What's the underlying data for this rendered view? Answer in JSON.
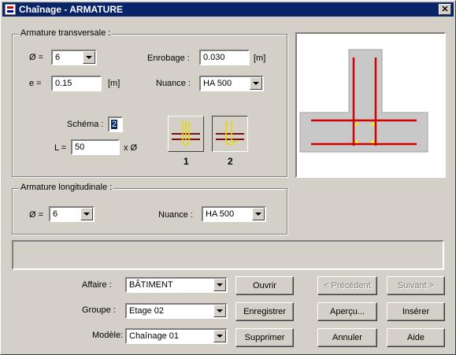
{
  "window": {
    "title": "Chaînage - ARMATURE",
    "close_glyph": "✕"
  },
  "transversale": {
    "legend": "Armature transversale :",
    "diam_label": "Ø =",
    "diam_value": "6",
    "e_label": "e =",
    "e_value": "0.15",
    "e_unit": "[m]",
    "enrobage_label": "Enrobage :",
    "enrobage_value": "0.030",
    "enrobage_unit": "[m]",
    "nuance_label": "Nuance :",
    "nuance_value": "HA 500",
    "schema_label": "Schéma :",
    "schema_value": "2",
    "L_label": "L =",
    "L_value": "50",
    "L_unit": "x Ø",
    "schema1_num": "1",
    "schema2_num": "2"
  },
  "longitudinale": {
    "legend": "Armature longitudinale :",
    "diam_label": "Ø =",
    "diam_value": "6",
    "nuance_label": "Nuance :",
    "nuance_value": "HA 500"
  },
  "bottom": {
    "affaire_label": "Affaire :",
    "affaire_value": "BÂTIMENT",
    "groupe_label": "Groupe :",
    "groupe_value": "Etage 02",
    "modele_label": "Modèle:",
    "modele_value": "Chaînage 01"
  },
  "buttons": {
    "ouvrir": "Ouvrir",
    "enregistrer": "Enregistrer",
    "supprimer": "Supprimer",
    "precedent": "< Précédent",
    "suivant": "Suivant >",
    "apercu": "Aperçu...",
    "inserer": "Insérer",
    "annuler": "Annuler",
    "aide": "Aide"
  },
  "colors": {
    "bar_red": "#d40000",
    "concrete": "#c8c8c8",
    "dot_yellow": "#f0f000",
    "stirrup_yellow": "#e8d800"
  }
}
